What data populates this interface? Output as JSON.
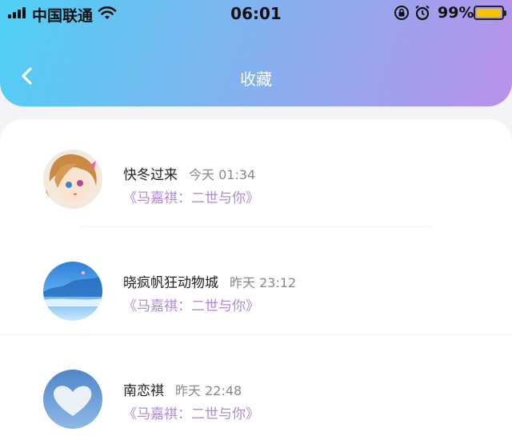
{
  "status_bar": {
    "carrier": "中国联通",
    "time": "06:01",
    "battery": "99%",
    "icons": [
      "signal-icon",
      "wifi-icon",
      "orientation-lock-icon",
      "alarm-icon",
      "battery-icon"
    ]
  },
  "header": {
    "title": "收藏",
    "back_icon": "chevron-left-icon",
    "gradient": [
      "#4fd0f6",
      "#b991ea"
    ]
  },
  "favorites": [
    {
      "name": "快冬过来",
      "time": "今天 01:34",
      "work": "《马嘉祺：二世与你》",
      "avatar": "anime-girl"
    },
    {
      "name": "晓疯帆狂动物城",
      "time": "昨天 23:12",
      "work": "《马嘉祺：二世与你》",
      "avatar": "blue-sea"
    },
    {
      "name": "南恋祺",
      "time": "昨天 22:48",
      "work": "《马嘉祺：二世与你》",
      "avatar": "heart-cloud"
    }
  ],
  "colors": {
    "accent": "#b08ad9",
    "time_text": "#888888"
  }
}
